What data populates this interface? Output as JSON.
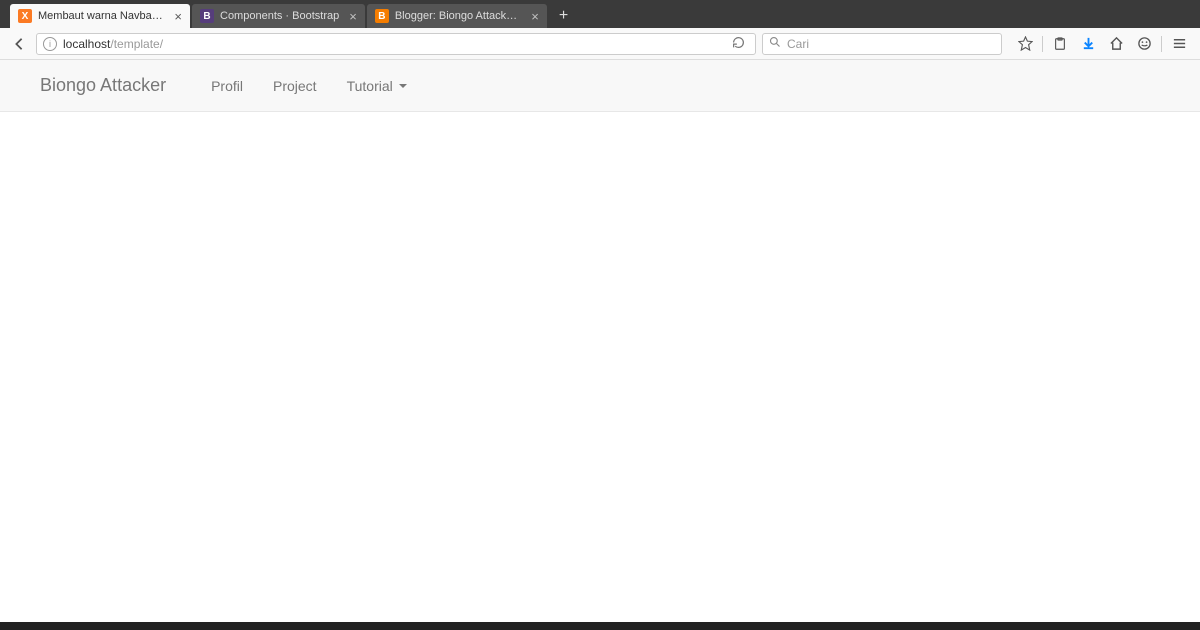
{
  "tabs": [
    {
      "title": "Membaut warna Navbar me...",
      "favicon": "xampp",
      "active": true
    },
    {
      "title": "Components · Bootstrap",
      "favicon": "bootstrap",
      "active": false
    },
    {
      "title": "Blogger: Biongo Attacker - ...",
      "favicon": "blogger",
      "active": false
    }
  ],
  "url": {
    "host": "localhost",
    "path": "/template/"
  },
  "search": {
    "placeholder": "Cari"
  },
  "navbar": {
    "brand": "Biongo Attacker",
    "items": [
      {
        "label": "Profil",
        "dropdown": false
      },
      {
        "label": "Project",
        "dropdown": false
      },
      {
        "label": "Tutorial",
        "dropdown": true
      }
    ]
  }
}
